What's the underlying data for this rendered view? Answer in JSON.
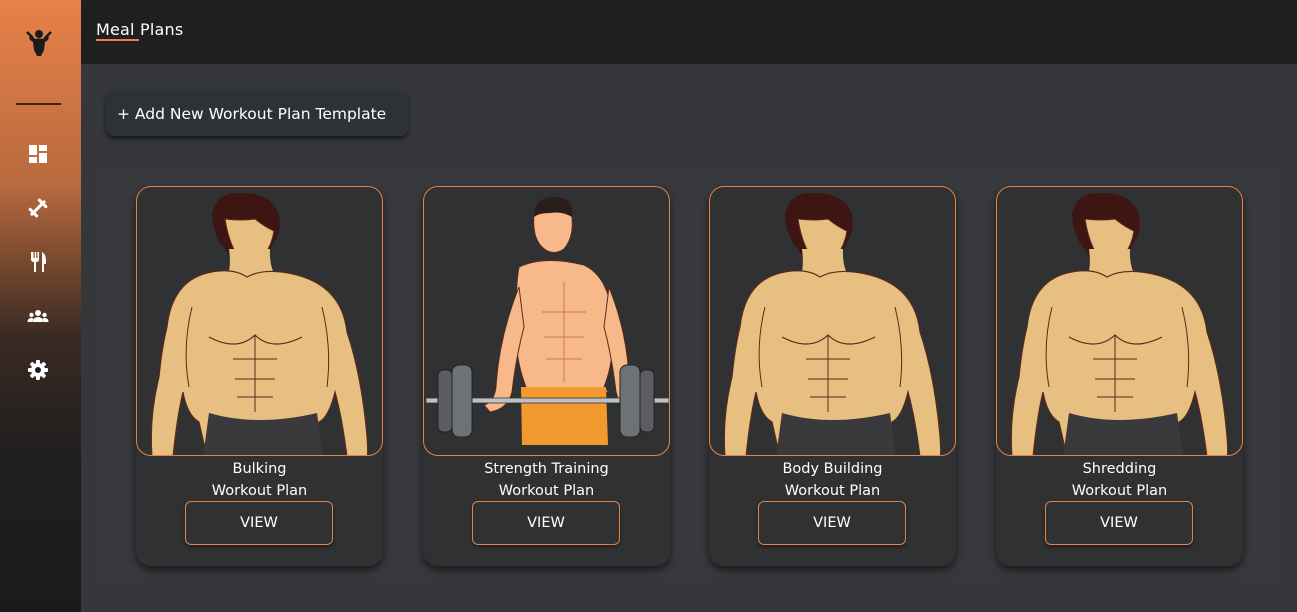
{
  "app": {
    "logo_icon": "bodybuilder-logo-icon"
  },
  "sidebar": {
    "items": [
      {
        "icon": "dashboard-icon"
      },
      {
        "icon": "dumbbell-icon"
      },
      {
        "icon": "fork-knife-icon"
      },
      {
        "icon": "users-icon"
      },
      {
        "icon": "gear-icon"
      }
    ]
  },
  "header": {
    "title": "Meal Plans"
  },
  "toolbar": {
    "add_label": "+ Add New Workout Plan Template"
  },
  "plans": [
    {
      "name": "Bulking",
      "subtitle": "Workout Plan",
      "action": "VIEW",
      "image": "muscular-man-illustration"
    },
    {
      "name": "Strength Training",
      "subtitle": "Workout Plan",
      "action": "VIEW",
      "image": "man-lifting-barbell-illustration"
    },
    {
      "name": "Body Building",
      "subtitle": "Workout Plan",
      "action": "VIEW",
      "image": "muscular-man-illustration"
    },
    {
      "name": "Shredding",
      "subtitle": "Workout Plan",
      "action": "VIEW",
      "image": "muscular-man-illustration"
    }
  ],
  "colors": {
    "accent": "#e8814a",
    "background": "#35373a",
    "card": "#2f3133",
    "topbar": "#1f1f20"
  }
}
